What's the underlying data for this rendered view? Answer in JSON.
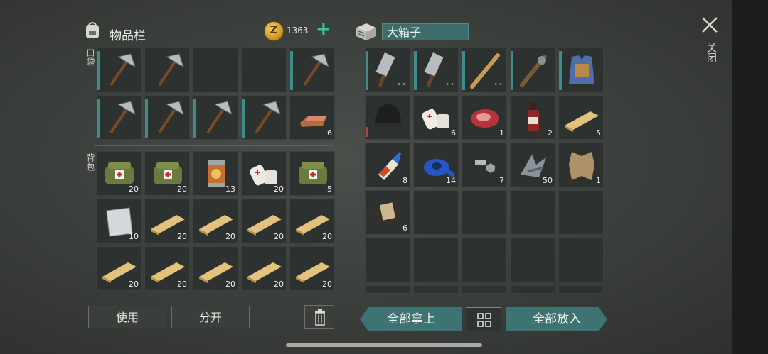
{
  "inventory": {
    "title": "物品栏",
    "coins": "1363",
    "plus": "+",
    "pocket_label": "口袋",
    "backpack_label": "背包",
    "pocket_slots": [
      {
        "item": "pickaxe",
        "qty": "",
        "durability": true
      },
      {
        "item": "pickaxe",
        "qty": "",
        "durability": false
      },
      {
        "item": "",
        "qty": "",
        "durability": false
      },
      {
        "item": "",
        "qty": "",
        "durability": false
      },
      {
        "item": "pickaxe",
        "qty": "",
        "durability": true
      },
      {
        "item": "pickaxe",
        "qty": "",
        "durability": true
      },
      {
        "item": "pickaxe",
        "qty": "",
        "durability": true
      },
      {
        "item": "pickaxe",
        "qty": "",
        "durability": true
      },
      {
        "item": "pickaxe",
        "qty": "",
        "durability": true
      },
      {
        "item": "copper-ingot",
        "qty": "6",
        "durability": false
      }
    ],
    "backpack_slots": [
      {
        "item": "first-aid-bag",
        "qty": "20"
      },
      {
        "item": "first-aid-bag",
        "qty": "20"
      },
      {
        "item": "food-can",
        "qty": "13"
      },
      {
        "item": "bandage",
        "qty": "20"
      },
      {
        "item": "first-aid-bag",
        "qty": "5"
      },
      {
        "item": "metal-sheet",
        "qty": "10"
      },
      {
        "item": "wood-plank",
        "qty": "20"
      },
      {
        "item": "wood-plank",
        "qty": "20"
      },
      {
        "item": "wood-plank",
        "qty": "20"
      },
      {
        "item": "wood-plank",
        "qty": "20"
      },
      {
        "item": "wood-plank",
        "qty": "20"
      },
      {
        "item": "wood-plank",
        "qty": "20"
      },
      {
        "item": "wood-plank",
        "qty": "20"
      },
      {
        "item": "wood-plank",
        "qty": "20"
      },
      {
        "item": "wood-plank",
        "qty": "20"
      }
    ],
    "use_button": "使用",
    "split_button": "分开"
  },
  "chest": {
    "title": "大箱子",
    "slots": [
      {
        "item": "cleaver",
        "qty": "",
        "dots": "••",
        "durability": true
      },
      {
        "item": "cleaver",
        "qty": "",
        "dots": "••",
        "durability": true
      },
      {
        "item": "baseball-bat",
        "qty": "",
        "dots": "••",
        "durability": true
      },
      {
        "item": "nail-bat",
        "qty": "",
        "dots": "",
        "durability": true
      },
      {
        "item": "armor-vest",
        "qty": "",
        "dots": "",
        "durability": true
      },
      {
        "item": "beanie",
        "qty": "",
        "dots": "",
        "durability": "red"
      },
      {
        "item": "bandage",
        "qty": "6",
        "dots": "",
        "durability": false
      },
      {
        "item": "raw-meat",
        "qty": "1",
        "dots": "",
        "durability": false
      },
      {
        "item": "bottle",
        "qty": "2",
        "dots": "",
        "durability": false
      },
      {
        "item": "wood-plank",
        "qty": "5",
        "dots": "",
        "durability": false
      },
      {
        "item": "glue",
        "qty": "8",
        "dots": "",
        "durability": false
      },
      {
        "item": "duct-tape",
        "qty": "14",
        "dots": "",
        "durability": false
      },
      {
        "item": "bolts",
        "qty": "7",
        "dots": "",
        "durability": false
      },
      {
        "item": "scrap-metal",
        "qty": "50",
        "dots": "",
        "durability": false
      },
      {
        "item": "leather",
        "qty": "1",
        "dots": "",
        "durability": false
      },
      {
        "item": "wallet",
        "qty": "6",
        "dots": "",
        "durability": false
      }
    ],
    "take_all": "全部拿上",
    "put_all": "全部放入"
  },
  "close_label": "关闭",
  "colors": {
    "accent": "#3d7473",
    "coin_plus": "#3ec39a",
    "durability": "#3f8c8a",
    "durability_low": "#c73c3c"
  }
}
